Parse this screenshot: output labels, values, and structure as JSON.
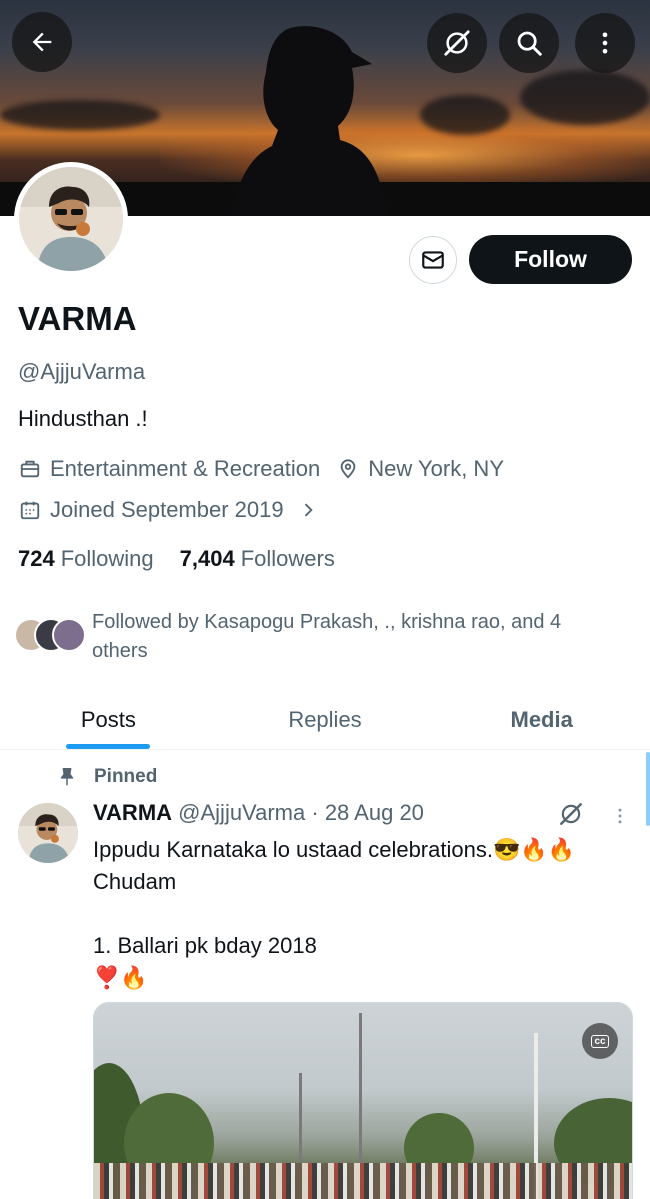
{
  "header": {
    "back_icon": "arrow-left-icon",
    "grok_icon": "grok-icon",
    "search_icon": "search-icon",
    "more_icon": "more-vertical-icon"
  },
  "profile": {
    "name": "VARMA",
    "handle": "@AjjjuVarma",
    "bio": "Hindusthan .!",
    "category": "Entertainment & Recreation",
    "location": "New York, NY",
    "joined": "Joined September 2019",
    "following_count": "724",
    "following_label": "Following",
    "followers_count": "7,404",
    "followers_label": "Followers",
    "followed_by": "Followed by Kasapogu Prakash, ., krishna rao, and 4 others"
  },
  "actions": {
    "message_icon": "envelope-icon",
    "follow_label": "Follow"
  },
  "tabs": [
    {
      "label": "Posts"
    },
    {
      "label": "Replies"
    },
    {
      "label": "Media"
    }
  ],
  "post": {
    "pinned_label": "Pinned",
    "author_name": "VARMA",
    "author_handle": "@AjjjuVarma",
    "separator": "·",
    "date": "28 Aug 20",
    "line1": "Ippudu Karnataka lo ustaad celebrations.😎🔥🔥",
    "line2": "Chudam",
    "line3": "1. Ballari pk bday 2018",
    "line4": "❣️🔥",
    "cc_label": "cc"
  },
  "colors": {
    "accent": "#1d9bf0",
    "text_primary": "#0f1419",
    "text_secondary": "#536471",
    "follow_bg": "#0f1419"
  }
}
